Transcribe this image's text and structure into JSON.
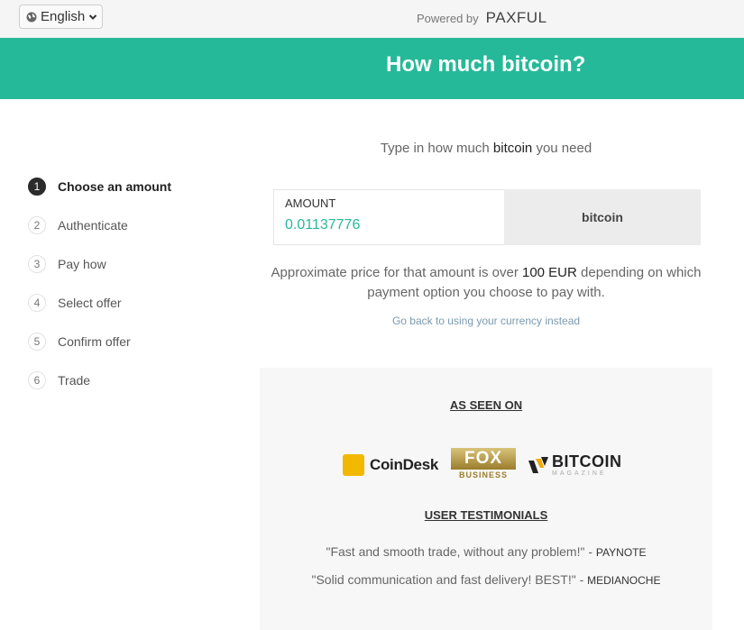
{
  "topbar": {
    "language": "English",
    "powered_by": "Powered by",
    "brand": "PAXFUL"
  },
  "header": {
    "title": "How much bitcoin?"
  },
  "steps": [
    {
      "number": "1",
      "label": "Choose an amount",
      "active": true
    },
    {
      "number": "2",
      "label": "Authenticate"
    },
    {
      "number": "3",
      "label": "Pay how"
    },
    {
      "number": "4",
      "label": "Select offer"
    },
    {
      "number": "5",
      "label": "Confirm offer"
    },
    {
      "number": "6",
      "label": "Trade"
    }
  ],
  "main": {
    "instruction_pre": "Type in how much",
    "instruction_bold": "bitcoin",
    "instruction_post": "you need",
    "amount_label": "AMOUNT",
    "amount_value": "0.01137776",
    "unit": "bitcoin",
    "approx_pre": "Approximate price for that amount is over",
    "approx_bold": "100 EUR",
    "approx_post": "depending on which payment option you choose to pay with.",
    "go_back": "Go back to using your currency instead"
  },
  "panel": {
    "seen_on_title": "AS SEEN ON",
    "logos": {
      "coindesk": "CoinDesk",
      "fox_top": "FOX",
      "fox_bottom": "BUSINESS",
      "btc_top": "BITCOIN",
      "btc_bottom": "MAGAZINE"
    },
    "testimonials_title": "USER TESTIMONIALS",
    "testimonials": [
      {
        "quote": "\"Fast and smooth trade, without any problem!\"",
        "author": "PAYNOTE"
      },
      {
        "quote": "\"Solid communication and fast delivery! BEST!\"",
        "author": "MEDIANOCHE"
      }
    ]
  },
  "colors": {
    "accent": "#26b999",
    "header_text": "#ffffff",
    "link": "#7a9ab0"
  }
}
